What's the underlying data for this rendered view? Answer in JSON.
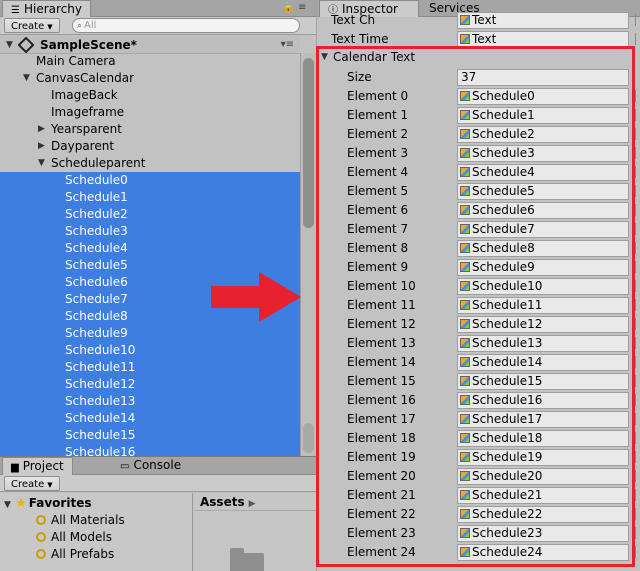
{
  "hierarchy": {
    "tab_label": "Hierarchy",
    "create_label": "Create",
    "search_placeholder": "All",
    "scene": "SampleScene*",
    "items": [
      {
        "label": "Main Camera",
        "depth": 1,
        "expand": "",
        "selected": false
      },
      {
        "label": "CanvasCalendar",
        "depth": 1,
        "expand": "open",
        "selected": false
      },
      {
        "label": "ImageBack",
        "depth": 2,
        "expand": "",
        "selected": false
      },
      {
        "label": "Imageframe",
        "depth": 2,
        "expand": "",
        "selected": false
      },
      {
        "label": "Yearsparent",
        "depth": 2,
        "expand": "closed",
        "selected": false
      },
      {
        "label": "Dayparent",
        "depth": 2,
        "expand": "closed",
        "selected": false
      },
      {
        "label": "Scheduleparent",
        "depth": 2,
        "expand": "open",
        "selected": false
      },
      {
        "label": "Schedule0",
        "depth": 3,
        "expand": "",
        "selected": true
      },
      {
        "label": "Schedule1",
        "depth": 3,
        "expand": "",
        "selected": true
      },
      {
        "label": "Schedule2",
        "depth": 3,
        "expand": "",
        "selected": true
      },
      {
        "label": "Schedule3",
        "depth": 3,
        "expand": "",
        "selected": true
      },
      {
        "label": "Schedule4",
        "depth": 3,
        "expand": "",
        "selected": true
      },
      {
        "label": "Schedule5",
        "depth": 3,
        "expand": "",
        "selected": true
      },
      {
        "label": "Schedule6",
        "depth": 3,
        "expand": "",
        "selected": true
      },
      {
        "label": "Schedule7",
        "depth": 3,
        "expand": "",
        "selected": true
      },
      {
        "label": "Schedule8",
        "depth": 3,
        "expand": "",
        "selected": true
      },
      {
        "label": "Schedule9",
        "depth": 3,
        "expand": "",
        "selected": true
      },
      {
        "label": "Schedule10",
        "depth": 3,
        "expand": "",
        "selected": true
      },
      {
        "label": "Schedule11",
        "depth": 3,
        "expand": "",
        "selected": true
      },
      {
        "label": "Schedule12",
        "depth": 3,
        "expand": "",
        "selected": true
      },
      {
        "label": "Schedule13",
        "depth": 3,
        "expand": "",
        "selected": true
      },
      {
        "label": "Schedule14",
        "depth": 3,
        "expand": "",
        "selected": true
      },
      {
        "label": "Schedule15",
        "depth": 3,
        "expand": "",
        "selected": true
      },
      {
        "label": "Schedule16",
        "depth": 3,
        "expand": "",
        "selected": true
      }
    ]
  },
  "project": {
    "tab_project": "Project",
    "tab_console": "Console",
    "create_label": "Create",
    "favorites_label": "Favorites",
    "favorites": [
      "All Materials",
      "All Models",
      "All Prefabs"
    ],
    "assets_label": "Assets"
  },
  "inspector": {
    "tab_inspector": "Inspector",
    "tab_services": "Services",
    "top_fields": [
      {
        "label": "Text Ch",
        "value": "Text"
      },
      {
        "label": "Text Time",
        "value": "Text"
      }
    ],
    "section_label": "Calendar Text",
    "size_label": "Size",
    "size_value": "37",
    "elements": [
      {
        "label": "Element 0",
        "value": "Schedule0"
      },
      {
        "label": "Element 1",
        "value": "Schedule1"
      },
      {
        "label": "Element 2",
        "value": "Schedule2"
      },
      {
        "label": "Element 3",
        "value": "Schedule3"
      },
      {
        "label": "Element 4",
        "value": "Schedule4"
      },
      {
        "label": "Element 5",
        "value": "Schedule5"
      },
      {
        "label": "Element 6",
        "value": "Schedule6"
      },
      {
        "label": "Element 7",
        "value": "Schedule7"
      },
      {
        "label": "Element 8",
        "value": "Schedule8"
      },
      {
        "label": "Element 9",
        "value": "Schedule9"
      },
      {
        "label": "Element 10",
        "value": "Schedule10"
      },
      {
        "label": "Element 11",
        "value": "Schedule11"
      },
      {
        "label": "Element 12",
        "value": "Schedule12"
      },
      {
        "label": "Element 13",
        "value": "Schedule13"
      },
      {
        "label": "Element 14",
        "value": "Schedule14"
      },
      {
        "label": "Element 15",
        "value": "Schedule15"
      },
      {
        "label": "Element 16",
        "value": "Schedule16"
      },
      {
        "label": "Element 17",
        "value": "Schedule17"
      },
      {
        "label": "Element 18",
        "value": "Schedule18"
      },
      {
        "label": "Element 19",
        "value": "Schedule19"
      },
      {
        "label": "Element 20",
        "value": "Schedule20"
      },
      {
        "label": "Element 21",
        "value": "Schedule21"
      },
      {
        "label": "Element 22",
        "value": "Schedule22"
      },
      {
        "label": "Element 23",
        "value": "Schedule23"
      },
      {
        "label": "Element 24",
        "value": "Schedule24"
      }
    ]
  },
  "colors": {
    "selection": "#3d7ee0",
    "highlight_box": "#e8212e",
    "arrow": "#e8212e"
  }
}
